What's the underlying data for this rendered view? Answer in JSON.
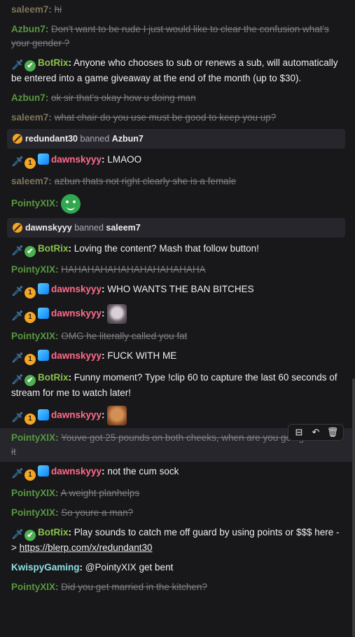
{
  "messages": [
    {
      "type": "deleted",
      "user": "saleem7",
      "color": "olive",
      "text": "hi"
    },
    {
      "type": "deleted",
      "user": "Azbun7",
      "color": "green",
      "text": "Don't want to be rude I just would like to clear the confusion what's your gender ?"
    },
    {
      "type": "bot",
      "user": "BotRix",
      "text": "Anyone who chooses to sub or renews a sub, will automatically be entered into a game giveaway at the end of the month (up to $30)."
    },
    {
      "type": "deleted",
      "user": "Azbun7",
      "color": "green",
      "text": "ok sir that's okay how u doing man"
    },
    {
      "type": "deleted",
      "user": "saleem7",
      "color": "olive",
      "text": "what chair do you use must be good to keep you up?"
    },
    {
      "type": "notice",
      "actor": "redundant30",
      "action": "banned",
      "target": "Azbun7"
    },
    {
      "type": "mod",
      "user": "dawnskyyy",
      "text": "LMAOO"
    },
    {
      "type": "deleted",
      "user": "saleem7",
      "color": "olive",
      "text": "azbun thats not right clearly she is a female"
    },
    {
      "type": "emote",
      "user": "PointyXIX",
      "color": "green",
      "emote": "green-blob-emote"
    },
    {
      "type": "notice",
      "actor": "dawnskyyy",
      "action": "banned",
      "target": "saleem7"
    },
    {
      "type": "bot",
      "user": "BotRix",
      "text": "Loving the content? Mash that follow button!"
    },
    {
      "type": "deleted",
      "user": "PointyXIX",
      "color": "green",
      "text": "HAHAHAHAHAHAHAHAHAHAHA"
    },
    {
      "type": "mod",
      "user": "dawnskyyy",
      "text": "WHO WANTS THE BAN BITCHES"
    },
    {
      "type": "mod-emote",
      "user": "dawnskyyy",
      "emote": "cat-emote"
    },
    {
      "type": "deleted",
      "user": "PointyXIX",
      "color": "green",
      "text": "OMG he literally called you fat"
    },
    {
      "type": "mod",
      "user": "dawnskyyy",
      "text": "FUCK WITH ME"
    },
    {
      "type": "bot",
      "user": "BotRix",
      "text": "Funny moment? Type !clip 60 to capture the last 60 seconds of stream for me to watch later!"
    },
    {
      "type": "mod-emote",
      "user": "dawnskyyy",
      "emote": "face-emote"
    },
    {
      "type": "deleted-hover",
      "user": "PointyXIX",
      "color": "green",
      "text": "Youve got 25 pounds on both cheeks, when are you going to lose it"
    },
    {
      "type": "mod",
      "user": "dawnskyyy",
      "text": "not the cum sock"
    },
    {
      "type": "deleted",
      "user": "PointyXIX",
      "color": "green",
      "text": "A weight planhelps"
    },
    {
      "type": "deleted",
      "user": "PointyXIX",
      "color": "green",
      "text": "So youre a man?"
    },
    {
      "type": "bot-link",
      "user": "BotRix",
      "text": "Play sounds to catch me off guard by using points or $$$ here -> ",
      "link": "https://blerp.com/x/redundant30"
    },
    {
      "type": "plain",
      "user": "KwispyGaming",
      "color": "cyan",
      "text": "@PointyXIX get bent"
    },
    {
      "type": "deleted",
      "user": "PointyXIX",
      "color": "green",
      "text": "Did you get married in the kitchen?"
    }
  ],
  "badges": {
    "sword": "🗡",
    "verified": "✔",
    "coin": "1"
  },
  "hover_tools": {
    "pin": "pin-icon",
    "undo": "undo-icon",
    "delete": "trash-icon"
  },
  "colon": ":"
}
